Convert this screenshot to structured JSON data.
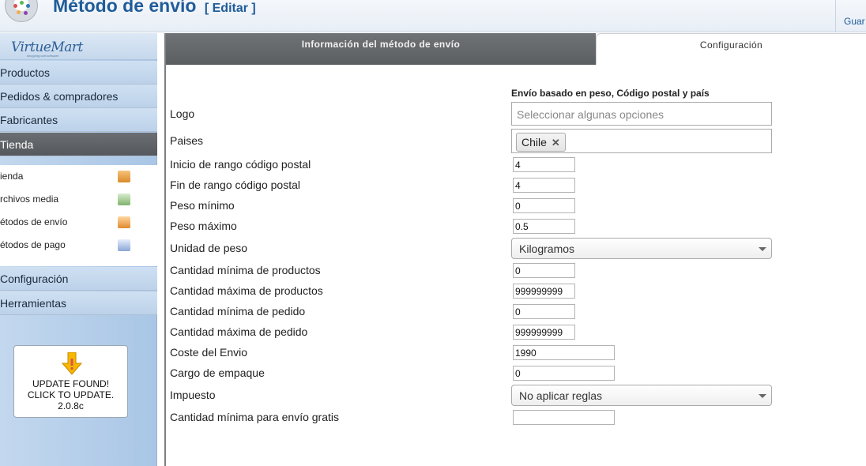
{
  "header": {
    "title": "Método de envío",
    "subtitle": "[ Editar ]",
    "save_label": "Guar"
  },
  "sidebar": {
    "brand": "VirtueMart",
    "brand_tag": "shopping cart software",
    "menu": [
      {
        "label": "Productos"
      },
      {
        "label": "Pedidos & compradores"
      },
      {
        "label": "Fabricantes"
      },
      {
        "label": "Tienda"
      }
    ],
    "submenu": [
      {
        "label": "ienda",
        "icon": "store-icon"
      },
      {
        "label": "rchivos media",
        "icon": "media-files-icon"
      },
      {
        "label": "étodos de envío",
        "icon": "shipping-truck-icon"
      },
      {
        "label": "étodos de pago",
        "icon": "payment-icon"
      }
    ],
    "menu_bottom": [
      {
        "label": "Configuración"
      },
      {
        "label": "Herramientas"
      }
    ],
    "update": {
      "line1": "UPDATE FOUND!",
      "line2": "CLICK TO UPDATE.",
      "version": "2.0.8c"
    }
  },
  "tabs": {
    "info": "Información del método de envío",
    "config": "Configuración"
  },
  "form": {
    "plugin_title": "Envío basado en peso, Código postal y país",
    "logo_label": "Logo",
    "logo_placeholder": "Seleccionar algunas opciones",
    "countries_label": "Paises",
    "country_chip": "Chile",
    "zip_start_label": "Inicio de rango código postal",
    "zip_start_value": "4",
    "zip_end_label": "Fin de rango código postal",
    "zip_end_value": "4",
    "weight_min_label": "Peso mínimo",
    "weight_min_value": "0",
    "weight_max_label": "Peso máximo",
    "weight_max_value": "0.5",
    "weight_unit_label": "Unidad de peso",
    "weight_unit_value": "Kilogramos",
    "nbproducts_min_label": "Cantidad mínima de productos",
    "nbproducts_min_value": "0",
    "nbproducts_max_label": "Cantidad máxima de productos",
    "nbproducts_max_value": "999999999",
    "orderamount_min_label": "Cantidad mínima de pedido",
    "orderamount_min_value": "0",
    "orderamount_max_label": "Cantidad máxima de pedido",
    "orderamount_max_value": "999999999",
    "cost_label": "Coste del Envio",
    "cost_value": "1990",
    "package_fee_label": "Cargo de empaque",
    "package_fee_value": "0",
    "tax_label": "Impuesto",
    "tax_value": "No aplicar reglas",
    "free_shipping_label": "Cantidad mínima para envío gratis",
    "free_shipping_value": ""
  }
}
